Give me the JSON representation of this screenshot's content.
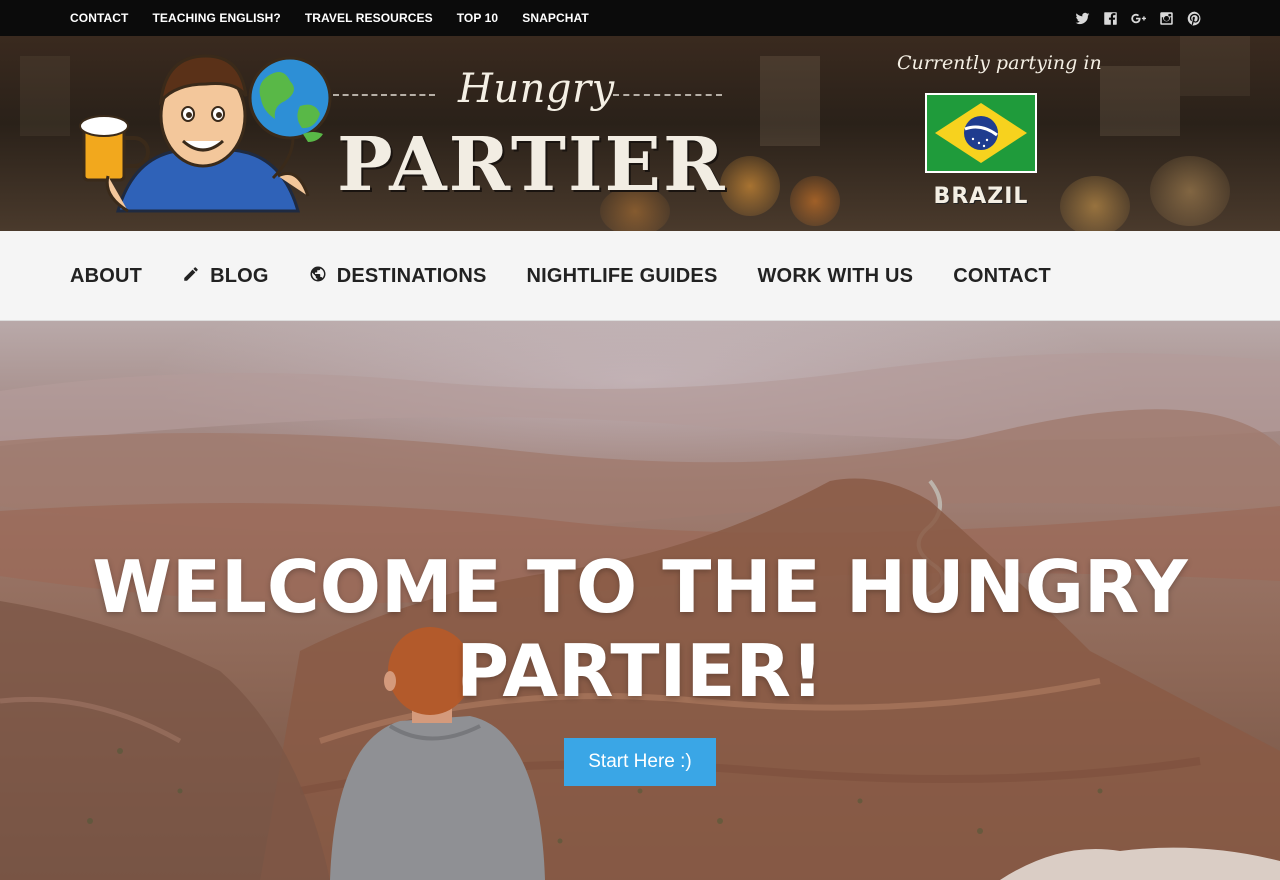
{
  "topbar": {
    "links": [
      "CONTACT",
      "TEACHING ENGLISH?",
      "TRAVEL RESOURCES",
      "TOP 10",
      "SNAPCHAT"
    ],
    "social_icons": [
      "twitter-icon",
      "facebook-icon",
      "google-plus-icon",
      "instagram-icon",
      "pinterest-icon"
    ]
  },
  "header": {
    "logo_word_1": "Hungry",
    "logo_word_2": "PARTIER",
    "currently_label": "Currently partying in",
    "country": "BRAZIL",
    "flag": "brazil-flag"
  },
  "mainnav": {
    "items": [
      {
        "label": "ABOUT",
        "icon": ""
      },
      {
        "label": "BLOG",
        "icon": "pencil-icon"
      },
      {
        "label": "DESTINATIONS",
        "icon": "globe-icon"
      },
      {
        "label": "NIGHTLIFE GUIDES",
        "icon": ""
      },
      {
        "label": "WORK WITH US",
        "icon": ""
      },
      {
        "label": "CONTACT",
        "icon": ""
      }
    ]
  },
  "hero": {
    "title": "WELCOME TO THE HUNGRY PARTIER!",
    "cta_label": "Start Here :)"
  },
  "colors": {
    "topbar_bg": "#0b0b0b",
    "nav_bg": "#f5f5f5",
    "cta_bg": "#3aa6e6",
    "brazil_green": "#1f9b3b",
    "brazil_yellow": "#f7d21e",
    "brazil_blue": "#1f3c8f"
  }
}
